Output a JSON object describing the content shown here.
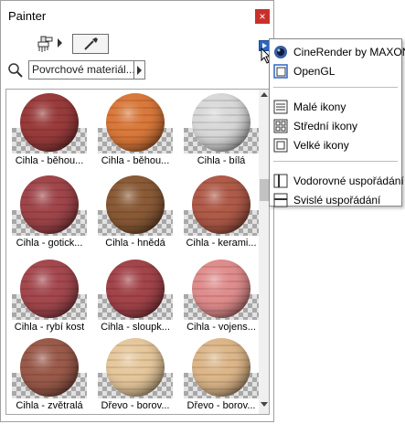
{
  "palette": {
    "title": "Painter",
    "close_label": "×",
    "filter_value": "Povrchové materiál...",
    "tools": {
      "brush": "paintbrush-icon",
      "dropper": "eyedropper-icon"
    }
  },
  "materials": [
    {
      "label": "Cihla - běhou...",
      "color": "#9a3b3b"
    },
    {
      "label": "Cihla - běhou...",
      "color": "#d9783a"
    },
    {
      "label": "Cihla - bílá",
      "color": "#d8d8d8"
    },
    {
      "label": "Cihla - gotick...",
      "color": "#a0454a"
    },
    {
      "label": "Cihla - hnědá",
      "color": "#8a5a36"
    },
    {
      "label": "Cihla - kerami...",
      "color": "#b05a48"
    },
    {
      "label": "Cihla - rybí kost",
      "color": "#a4484e"
    },
    {
      "label": "Cihla - sloupk...",
      "color": "#a3444a"
    },
    {
      "label": "Cihla - vojens...",
      "color": "#e08c8c"
    },
    {
      "label": "Cihla - zvětralá",
      "color": "#9a5a4a"
    },
    {
      "label": "Dřevo - borov...",
      "color": "#e6c79c"
    },
    {
      "label": "Dřevo - borov...",
      "color": "#dcb689"
    }
  ],
  "menu": {
    "groups": [
      [
        {
          "label": "CineRender by MAXON",
          "icon": "cinerender-icon"
        },
        {
          "label": "OpenGL",
          "icon": "opengl-icon"
        }
      ],
      [
        {
          "label": "Malé ikony",
          "icon": "small-icons-icon"
        },
        {
          "label": "Střední ikony",
          "icon": "medium-icons-icon"
        },
        {
          "label": "Velké ikony",
          "icon": "large-icons-icon"
        }
      ],
      [
        {
          "label": "Vodorovné uspořádání",
          "icon": "horizontal-layout-icon"
        },
        {
          "label": "Svislé uspořádání",
          "icon": "vertical-layout-icon"
        }
      ]
    ]
  },
  "colors": {
    "accent": "#2a66c9",
    "close": "#c9302c"
  }
}
